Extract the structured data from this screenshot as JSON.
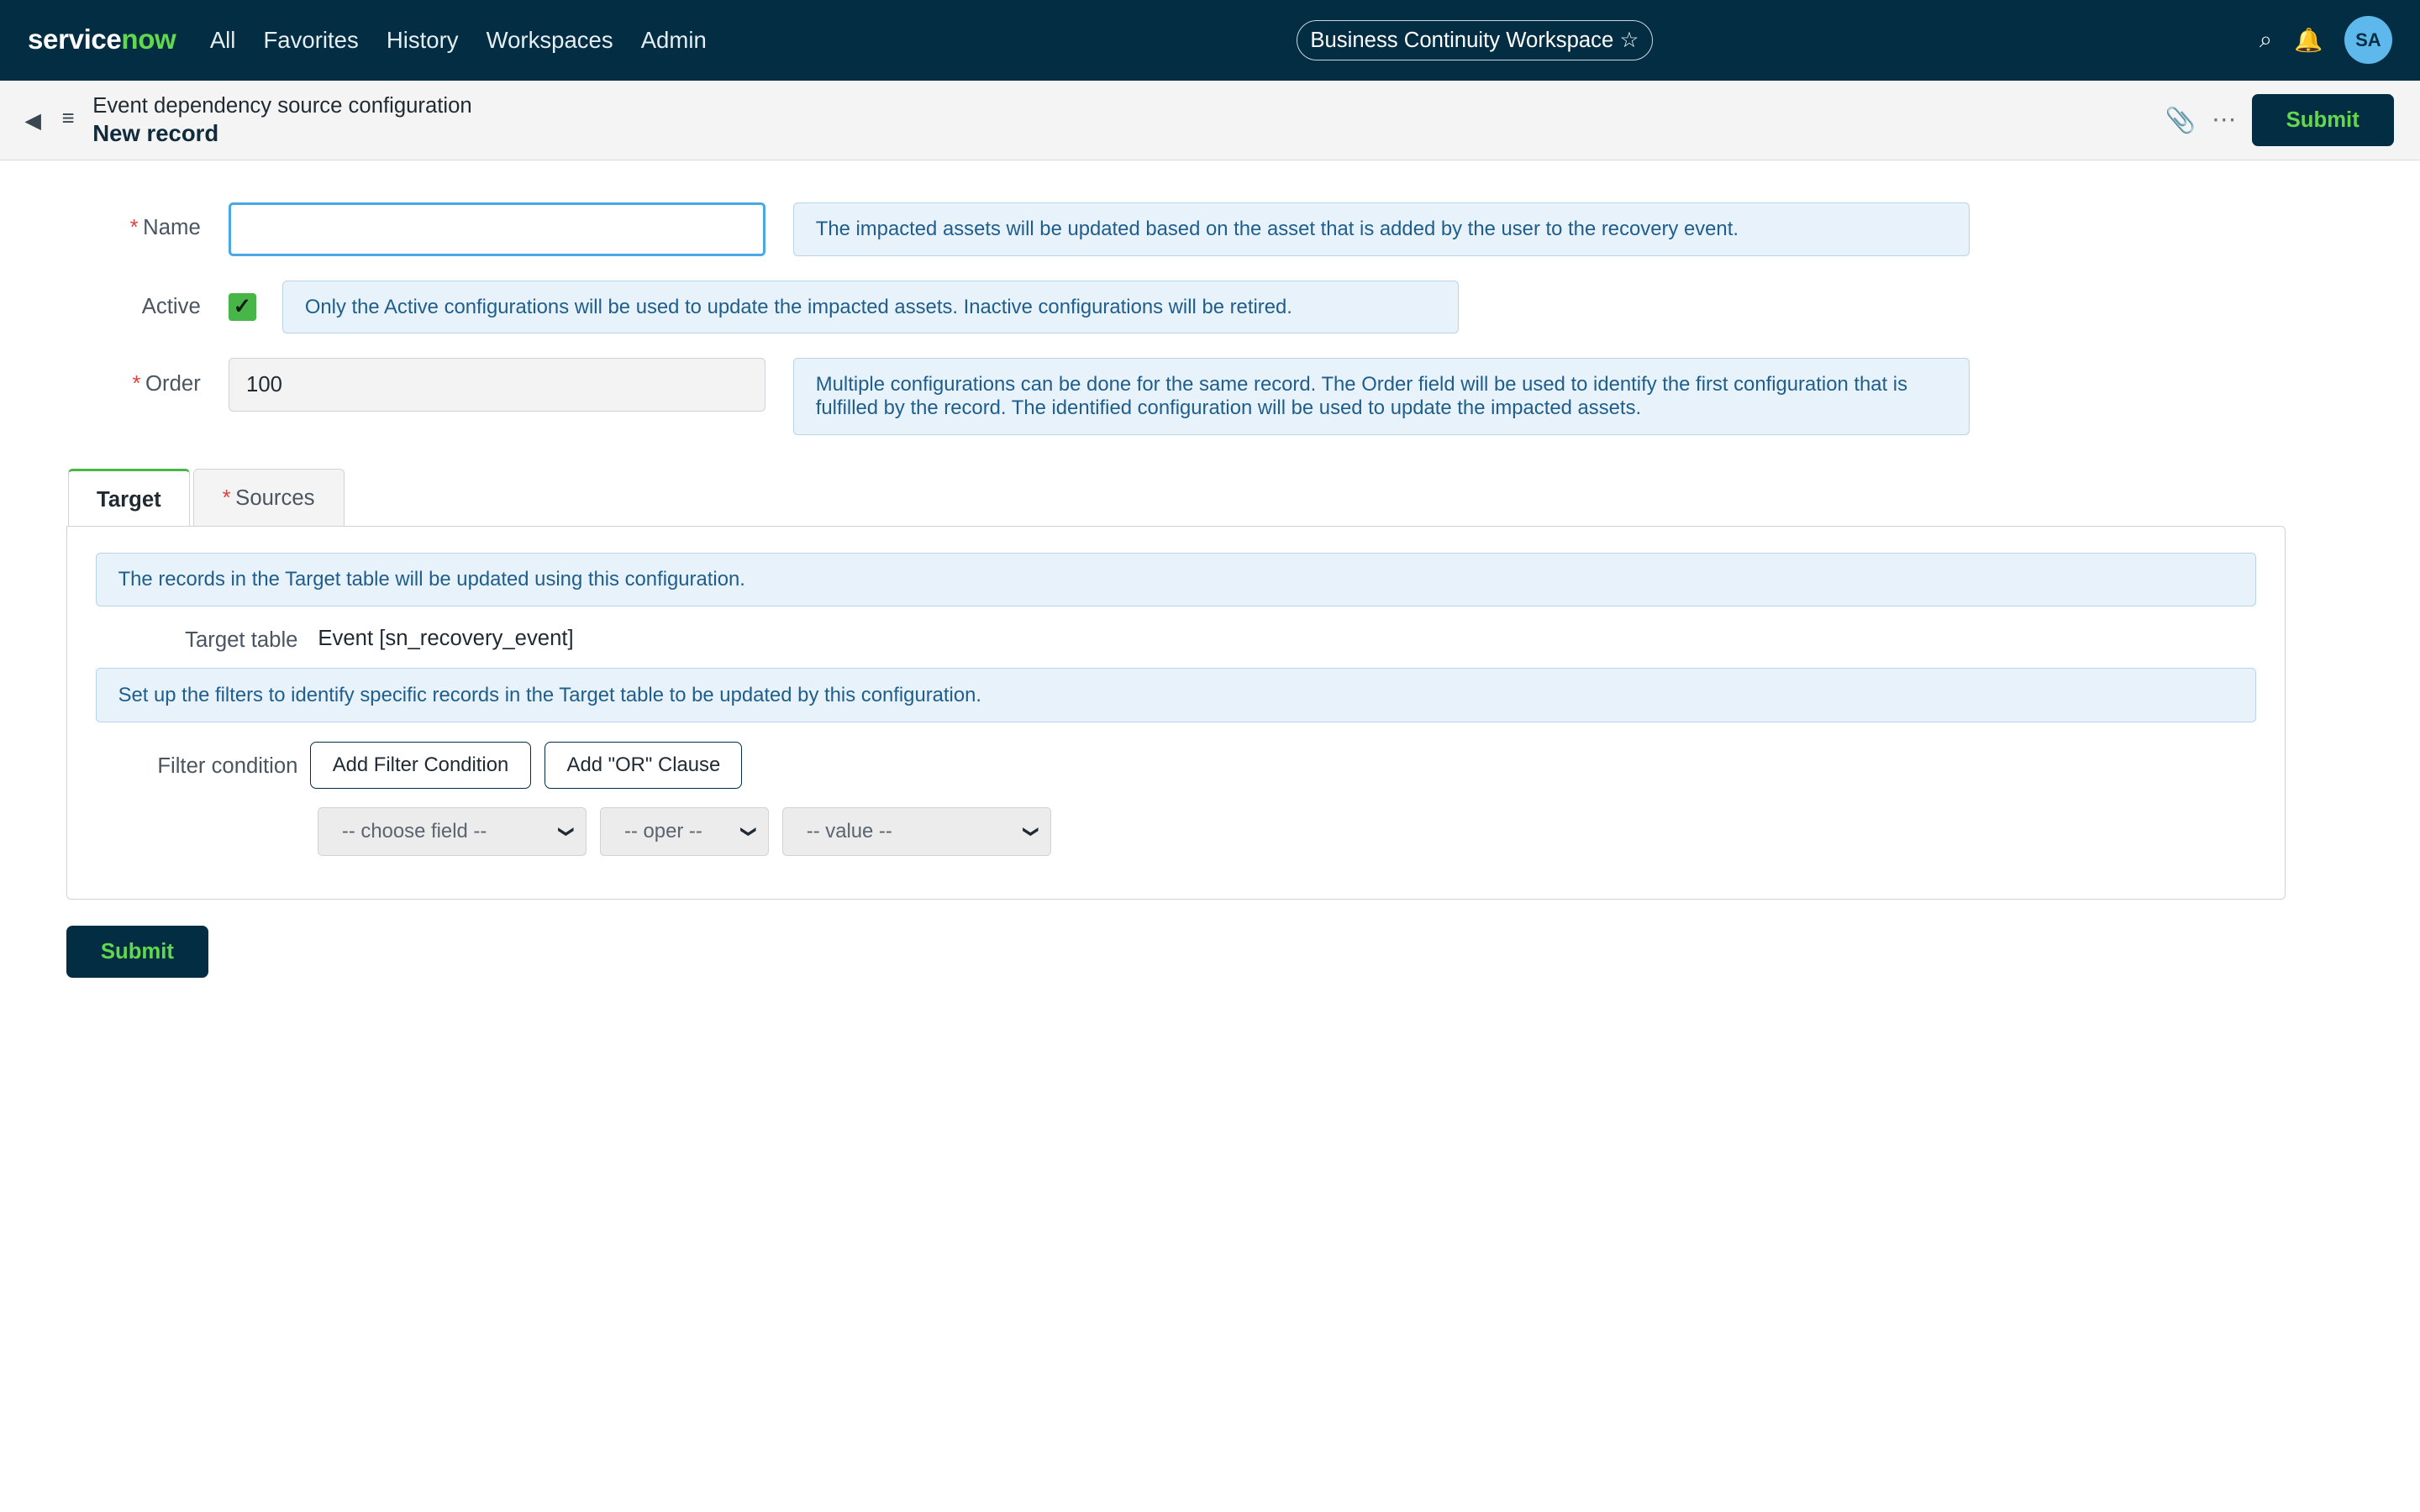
{
  "nav": {
    "logo_part1": "service",
    "logo_part2": "now",
    "menu": [
      "All",
      "Favorites",
      "History",
      "Workspaces",
      "Admin"
    ],
    "workspace": "Business Continuity Workspace ☆",
    "avatar_initials": "SA",
    "brand_colors": {
      "nav_bg": "#032d42",
      "accent": "#62d84e"
    }
  },
  "header": {
    "table_title": "Event dependency source configuration",
    "record": "New record",
    "submit": "Submit"
  },
  "form": {
    "name": {
      "label": "Name",
      "value": "",
      "hint": "The impacted assets will be updated based on the asset that is added by the user to the recovery event."
    },
    "active": {
      "label": "Active",
      "checked": true,
      "hint": "Only the Active configurations will be used to update the impacted assets. Inactive configurations will be retired."
    },
    "order": {
      "label": "Order",
      "value": "100",
      "hint": "Multiple configurations can be done for the same record. The Order field will be used to identify the first configuration that is fulfilled by the record. The identified configuration will be used to update the impacted assets."
    }
  },
  "tabs": [
    {
      "label": "Target",
      "active": true
    },
    {
      "label": "Sources",
      "required": true
    }
  ],
  "target": {
    "info": "The records in the Target table will be updated using this configuration.",
    "table_label": "Target table",
    "table_value": "Event [sn_recovery_event]",
    "filter_info": "Set up the filters to identify specific records in the Target table to be updated by this configuration.",
    "filter_label": "Filter condition",
    "add_filter": "Add Filter Condition",
    "add_or": "Add \"OR\" Clause",
    "field_select": "-- choose field --",
    "oper_select": "-- oper --",
    "value_select": "-- value --"
  },
  "footer": {
    "submit": "Submit"
  }
}
